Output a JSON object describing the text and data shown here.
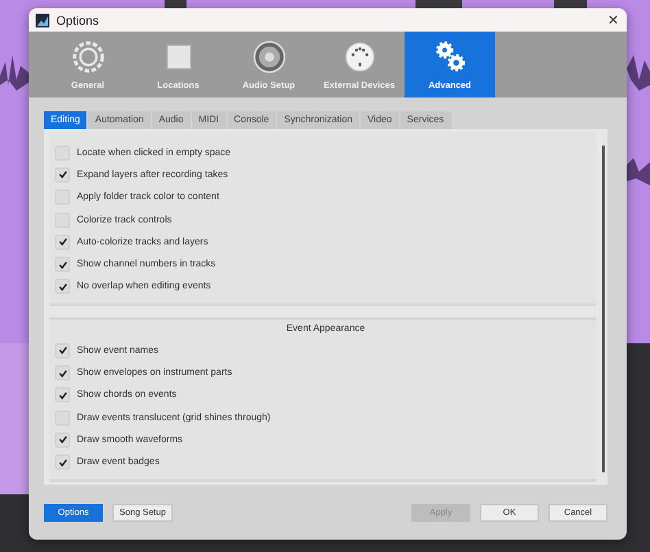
{
  "window": {
    "title": "Options",
    "close": "✕"
  },
  "categories": [
    {
      "label": "General",
      "kind": "general",
      "selected": false
    },
    {
      "label": "Locations",
      "kind": "locations",
      "selected": false
    },
    {
      "label": "Audio Setup",
      "kind": "audio",
      "selected": false
    },
    {
      "label": "External Devices",
      "kind": "devices",
      "selected": false
    },
    {
      "label": "Advanced",
      "kind": "advanced",
      "selected": true
    }
  ],
  "tabs": [
    {
      "label": "Editing",
      "selected": true
    },
    {
      "label": "Automation",
      "selected": false
    },
    {
      "label": "Audio",
      "selected": false
    },
    {
      "label": "MIDI",
      "selected": false
    },
    {
      "label": "Console",
      "selected": false
    },
    {
      "label": "Synchronization",
      "selected": false
    },
    {
      "label": "Video",
      "selected": false
    },
    {
      "label": "Services",
      "selected": false
    }
  ],
  "sections": [
    {
      "items": [
        {
          "label": "Locate when clicked in empty space",
          "checked": false
        },
        {
          "label": "Expand layers after recording takes",
          "checked": true
        },
        {
          "label": "Apply folder track color to content",
          "checked": false
        },
        {
          "label": "Colorize track controls",
          "checked": false
        },
        {
          "label": "Auto-colorize tracks and layers",
          "checked": true
        },
        {
          "label": "Show channel numbers in tracks",
          "checked": true
        },
        {
          "label": "No overlap when editing events",
          "checked": true
        }
      ]
    },
    {
      "heading": "Event Appearance",
      "items": [
        {
          "label": "Show event names",
          "checked": true
        },
        {
          "label": "Show envelopes on instrument parts",
          "checked": true
        },
        {
          "label": "Show chords on events",
          "checked": true
        },
        {
          "label": "Draw events translucent (grid shines through)",
          "checked": false
        },
        {
          "label": "Draw smooth waveforms",
          "checked": true
        },
        {
          "label": "Draw event badges",
          "checked": true
        }
      ]
    }
  ],
  "footer": [
    {
      "label": "Options",
      "kind": "primary",
      "disabled": false
    },
    {
      "label": "Song Setup",
      "kind": "normal",
      "disabled": false
    },
    {
      "label": "Apply",
      "kind": "normal",
      "disabled": true
    },
    {
      "label": "OK",
      "kind": "normal",
      "disabled": false
    },
    {
      "label": "Cancel",
      "kind": "normal",
      "disabled": false
    }
  ]
}
